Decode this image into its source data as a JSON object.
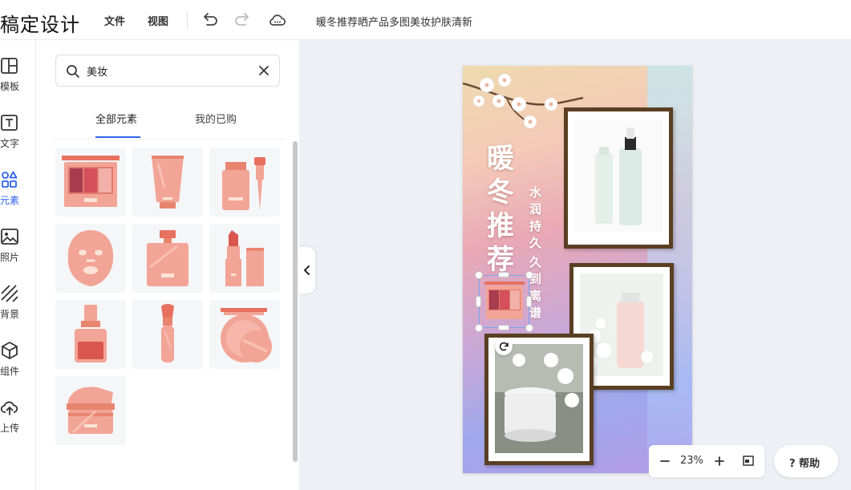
{
  "app": {
    "logo": "稿定设计"
  },
  "topbar": {
    "menu_file": "文件",
    "menu_view": "视图",
    "doc_title": "暖冬推荐晒产品多图美妆护肤清新"
  },
  "leftnav": {
    "items": [
      {
        "label": "模板",
        "icon": "template-icon"
      },
      {
        "label": "文字",
        "icon": "text-icon"
      },
      {
        "label": "元素",
        "icon": "elements-icon",
        "active": true
      },
      {
        "label": "照片",
        "icon": "photo-icon"
      },
      {
        "label": "背景",
        "icon": "background-icon"
      },
      {
        "label": "组件",
        "icon": "component-icon"
      },
      {
        "label": "上传",
        "icon": "upload-icon"
      }
    ]
  },
  "panel": {
    "search_value": "美妆",
    "tabs": [
      {
        "label": "全部元素",
        "active": true
      },
      {
        "label": "我的已购"
      }
    ],
    "elements": [
      "eyeshadow-palette",
      "cream-tube",
      "dropper-bottle",
      "face-mask",
      "perfume-bottle",
      "lipstick",
      "nail-polish",
      "makeup-brush",
      "powder-compact",
      "cream-jar"
    ]
  },
  "poster": {
    "title": "暖冬推荐",
    "subtitle_col1": "水润持久",
    "subtitle_col2": "久到离谱"
  },
  "zoom": {
    "value": "23%"
  },
  "help": {
    "label": "帮助"
  },
  "colors": {
    "accent": "#2f62e8",
    "element_pink": "#f2a496",
    "element_red": "#d9574f",
    "frame_brown": "#5a3f22"
  }
}
